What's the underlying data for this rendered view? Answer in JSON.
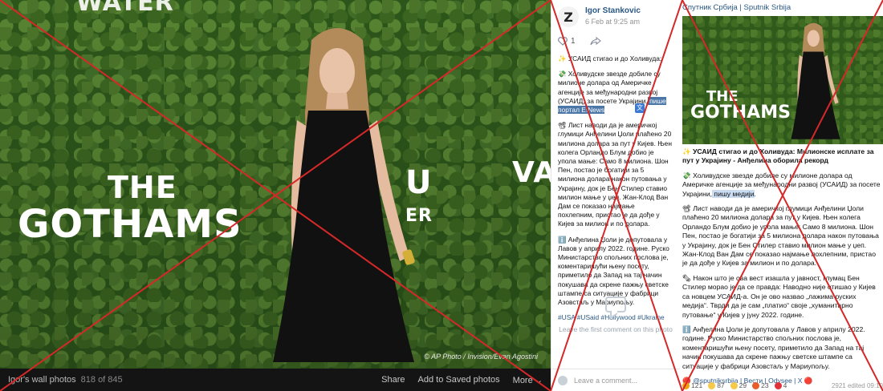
{
  "viewer": {
    "sign_water": "WATER",
    "sign_the": "THE",
    "sign_gothams": "GOTHAMS",
    "sign_va": "VA",
    "sign_vi": "U",
    "sign_er": "ER",
    "photo_credit": "© AP Photo / Invision/Evan Agostini",
    "album": "Igor's wall photos",
    "count": "818 of 845",
    "actions": [
      "Share",
      "Add to Saved photos",
      "More ⌄"
    ]
  },
  "post": {
    "avatar_letter": "Z",
    "author": "Igor Stankovic",
    "date": "6 Feb at 9:25 am",
    "likes": "1",
    "paragraphs": [
      {
        "pre": "✨ УСАИД стигао и до Холивуда:",
        "hl": "",
        "post": ""
      },
      {
        "pre": "💸 Холивудске звезде добиле су милионе долара од Америчке агенције за међународни развој (УСАИД) за посете Украјини,",
        "hl": " пише портал E!News",
        "post": ""
      },
      {
        "pre": "📽 Лист наводи да је америчкој глумици Анђелини Џоли плаћено 20 милиона долара за пут у Кијев. Њен колега Орландо Блум добио је упола мање: Само 8 милиона. Шон Пен, постао је богатији за 5 милиона долара након путовања у Украјину, док је Бен Стилер ставио милион мање у џеп. Жан-Клод Ван Дам се показао најмање похлепним, пристао је да дође у Кијев за милион и по долара.",
        "hl": "",
        "post": ""
      },
      {
        "pre": "ℹ️ Анђелина Џоли је допутовала у Лавов у априлу 2022. године. Руско Министарство спољних послова је, коментаришући њену посету, приметило да Запад на тај начин покушава да скрене пажњу светске штампе са ситуације у фабрици Азовстаљ у Мариупољу.",
        "hl": "",
        "post": ""
      }
    ],
    "hashtags": "#USA #USaid #Hollywood #Ukraine",
    "translate_icon": "文",
    "no_comments": "Leave the first comment on this photo",
    "comment_placeholder": "Leave a comment..."
  },
  "sputnik": {
    "header": "Спутник Србија | Sputnik Srbija",
    "sign_the": "THE",
    "sign_gothams": "GOTHAMS",
    "paragraphs": [
      {
        "pre": "✨ УСАИД стигао и до Холивуда: Милионске исплате за пут у Украјину - Анђелина оборила рекорд",
        "hl": "",
        "post": ""
      },
      {
        "pre": "💸 Холивудске звезде добиле су милионе долара од Америчке агенције за међународни развој (УСАИД) за посете Украјини,",
        "hl": " пишу медији",
        "post": "."
      },
      {
        "pre": "📽 Лист наводи да је америчкој глумици Анђелини Џоли плаћено 20 милиона долара за пут у Кијев. Њен колега Орландо Блум добио је упола мање: Само 8 милиона. Шон Пен, постао је богатији за 5 милиона долара након путовања у Украјину, док је Бен Стилер ставио милион мање у џеп. Жан-Клод Ван Дам се показао најмање похлепним, пристао је да дође у Кијев за милион и по долара.",
        "hl": "",
        "post": ""
      },
      {
        "pre": "🗞 Након што је ова вест изашла у јавност, глумац Бен Стилер морао је да се правда: Наводно није отишао у Кијев са новцем УСАИД-а. Он је ово назвао „лажима руских медија“. Тврди да је сам „платио“ своје „хуманитарно путовање“ у Кијев у јуну 2022. године.",
        "hl": "",
        "post": ""
      },
      {
        "pre": "ℹ️ Анђелина Џоли је допутовала у Лавов у априлу 2022. године. Руско Министарство спољних послова је, коментаришући њену посету, приметило да Запад на тај начин покушава да скрене пажњу светске штампе са ситуације у фабрици Азовстаљ у Мариупољу.",
        "hl": "",
        "post": ""
      }
    ],
    "links": "🔴 @sputniksrbija | Вести | Odysee | X 🔴",
    "reactions": [
      {
        "icon": "like",
        "count": "121",
        "color": "#f0a30a"
      },
      {
        "icon": "laugh",
        "count": "87",
        "color": "#f7c948"
      },
      {
        "icon": "wow",
        "count": "29",
        "color": "#f7c948"
      },
      {
        "icon": "fire",
        "count": "23",
        "color": "#e85d2a"
      },
      {
        "icon": "heart",
        "count": "4",
        "color": "#e0323a"
      }
    ],
    "views": "2921 edited 09:10"
  },
  "colors": {
    "link": "#2a5885",
    "cross": "#d62828",
    "highlight": "#4a76a8"
  }
}
